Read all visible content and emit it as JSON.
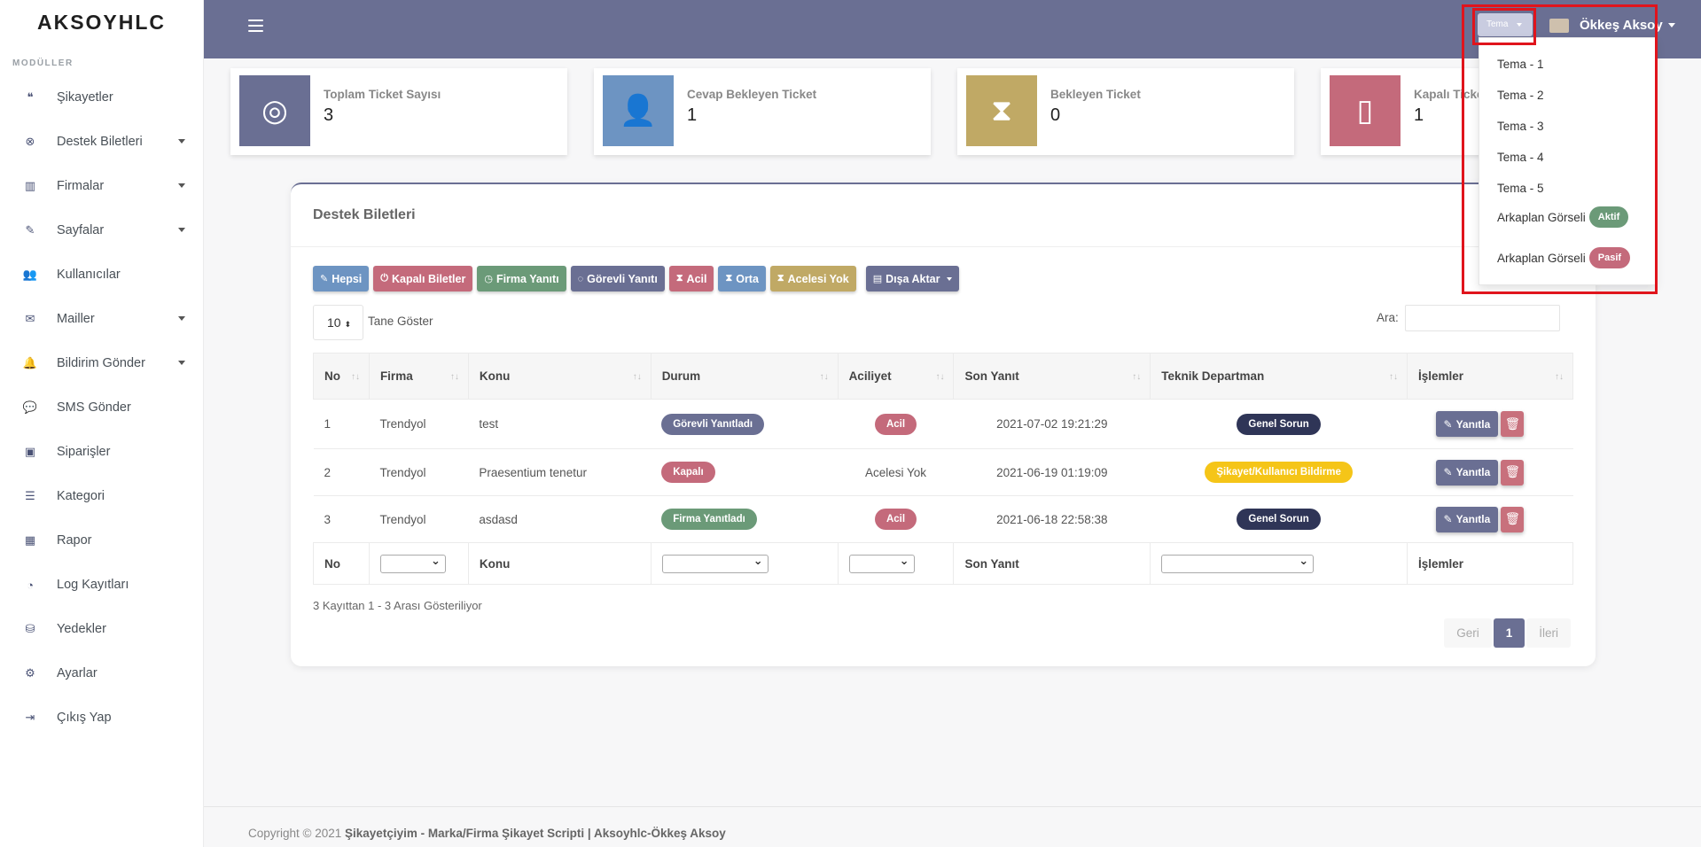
{
  "brand": "AKSOYHLC",
  "sidebar": {
    "section": "MODÜLLER",
    "items": [
      {
        "label": "Şikayetler",
        "icon": "quote-icon",
        "glyph": "❝",
        "caret": false
      },
      {
        "label": "Destek Biletleri",
        "icon": "lifebuoy-icon",
        "glyph": "⊗",
        "caret": true
      },
      {
        "label": "Firmalar",
        "icon": "building-icon",
        "glyph": "▥",
        "caret": true
      },
      {
        "label": "Sayfalar",
        "icon": "file-signature-icon",
        "glyph": "✎",
        "caret": true
      },
      {
        "label": "Kullanıcılar",
        "icon": "users-icon",
        "glyph": "👥",
        "caret": false
      },
      {
        "label": "Mailler",
        "icon": "envelope-icon",
        "glyph": "✉",
        "caret": true
      },
      {
        "label": "Bildirim Gönder",
        "icon": "bell-icon",
        "glyph": "🔔",
        "caret": true
      },
      {
        "label": "SMS Gönder",
        "icon": "comment-icon",
        "glyph": "💬",
        "caret": false
      },
      {
        "label": "Siparişler",
        "icon": "money-bill-icon",
        "glyph": "▣",
        "caret": false
      },
      {
        "label": "Kategori",
        "icon": "list-icon",
        "glyph": "☰",
        "caret": false
      },
      {
        "label": "Rapor",
        "icon": "chart-bar-icon",
        "glyph": "▦",
        "caret": false
      },
      {
        "label": "Log Kayıtları",
        "icon": "user-clock-icon",
        "glyph": "◔",
        "caret": false
      },
      {
        "label": "Yedekler",
        "icon": "database-icon",
        "glyph": "⛁",
        "caret": false
      },
      {
        "label": "Ayarlar",
        "icon": "cogs-icon",
        "glyph": "⚙",
        "caret": false
      },
      {
        "label": "Çıkış Yap",
        "icon": "sign-out-icon",
        "glyph": "⇥",
        "caret": false
      }
    ]
  },
  "topbar": {
    "theme_button": "Tema",
    "user_name": "Ökkeş Aksoy"
  },
  "stats": [
    {
      "label": "Toplam Ticket Sayısı",
      "value": "3",
      "color": "#6a6f93",
      "icon": "lifebuoy-icon",
      "glyph": "◎"
    },
    {
      "label": "Cevap Bekleyen Ticket",
      "value": "1",
      "color": "#6d94c2",
      "icon": "user-clock-icon",
      "glyph": "👤"
    },
    {
      "label": "Bekleyen Ticket",
      "value": "0",
      "color": "#c0a965",
      "icon": "hourglass-icon",
      "glyph": "⧗"
    },
    {
      "label": "Kapalı Ticket",
      "value": "1",
      "color": "#c46a7b",
      "icon": "door-closed-icon",
      "glyph": "▯"
    }
  ],
  "card": {
    "title": "Destek Biletleri",
    "filters": [
      {
        "label": "Hepsi",
        "glyph": "✎",
        "color": "#6d94c2"
      },
      {
        "label": "Kapalı Biletler",
        "glyph": "⏻",
        "color": "#c46a7b"
      },
      {
        "label": "Firma Yanıtı",
        "glyph": "◷",
        "color": "#6b9a78"
      },
      {
        "label": "Görevli Yanıtı",
        "glyph": "◌",
        "color": "#6a6f93"
      },
      {
        "label": "Acil",
        "glyph": "⧗",
        "color": "#c46a7b"
      },
      {
        "label": "Orta",
        "glyph": "⧗",
        "color": "#6d94c2"
      },
      {
        "label": "Acelesi Yok",
        "glyph": "⧗",
        "color": "#c0a965"
      },
      {
        "label": "Dışa Aktar",
        "glyph": "▤",
        "color": "#6a6f93"
      }
    ],
    "page_length": "10",
    "page_length_label": "Tane Göster",
    "search_label": "Ara:",
    "columns": [
      "No",
      "Firma",
      "Konu",
      "Durum",
      "Aciliyet",
      "Son Yanıt",
      "Teknik Departman",
      "İşlemler"
    ],
    "rows": [
      {
        "no": "1",
        "firma": "Trendyol",
        "konu": "test",
        "durum": "Görevli Yanıtladı",
        "durum_color": "#6a6f93",
        "aciliyet": "Acil",
        "aciliyet_pill": true,
        "son": "2021-07-02 19:21:29",
        "dept": "Genel Sorun",
        "dept_color": "#2f3557"
      },
      {
        "no": "2",
        "firma": "Trendyol",
        "konu": "Praesentium tenetur",
        "durum": "Kapalı",
        "durum_color": "#c46a7b",
        "aciliyet": "Acelesi Yok",
        "aciliyet_pill": false,
        "son": "2021-06-19 01:19:09",
        "dept": "Şikayet/Kullanıcı Bildirme",
        "dept_color": "#f5c518"
      },
      {
        "no": "3",
        "firma": "Trendyol",
        "konu": "asdasd",
        "durum": "Firma Yanıtladı",
        "durum_color": "#6b9a78",
        "aciliyet": "Acil",
        "aciliyet_pill": true,
        "son": "2021-06-18 22:58:38",
        "dept": "Genel Sorun",
        "dept_color": "#2f3557"
      }
    ],
    "reply_label": "Yanıtla",
    "footer_row": {
      "no": "No",
      "konu": "Konu",
      "son": "Son Yanıt",
      "islemler": "İşlemler"
    },
    "info": "3 Kayıttan 1 - 3 Arası Gösteriliyor",
    "pager": {
      "prev": "Geri",
      "current": "1",
      "next": "İleri"
    }
  },
  "footer": {
    "prefix": "Copyright © 2021",
    "text": "Şikayetçiyim - Marka/Firma Şikayet Scripti | Aksoyhlc-Ökkeş Aksoy"
  },
  "theme_menu": {
    "items": [
      "Tema - 1",
      "Tema - 2",
      "Tema - 3",
      "Tema - 4",
      "Tema - 5"
    ],
    "bg_label": "Arkaplan Görseli",
    "active_badge": "Aktif",
    "passive_badge": "Pasif",
    "active_color": "#6b9a78",
    "passive_color": "#c46a7b"
  }
}
